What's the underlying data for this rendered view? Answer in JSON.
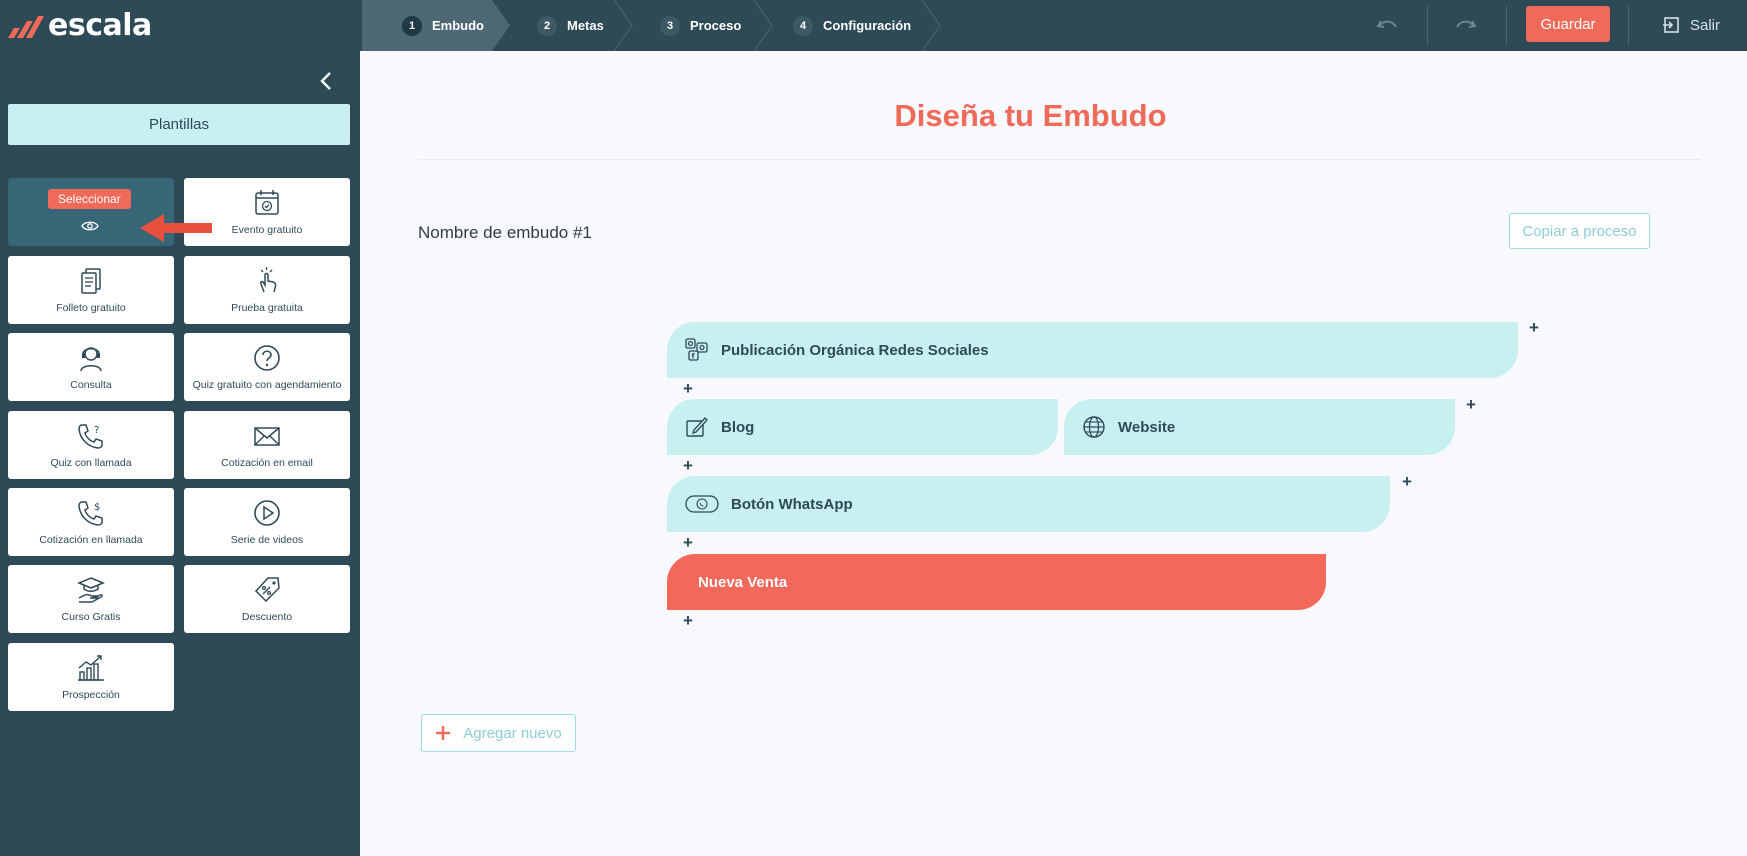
{
  "app": {
    "logo_text": "escala"
  },
  "steps": [
    {
      "num": "1",
      "label": "Embudo"
    },
    {
      "num": "2",
      "label": "Metas"
    },
    {
      "num": "3",
      "label": "Proceso"
    },
    {
      "num": "4",
      "label": "Configuración"
    }
  ],
  "toolbar": {
    "save_label": "Guardar",
    "exit_label": "Salir"
  },
  "sidebar": {
    "templates_label": "Plantillas",
    "selected_badge": "Seleccionar",
    "tiles": [
      {
        "label": "Evento gratuito",
        "icon": "calendar-check-icon"
      },
      {
        "label": "Folleto gratuito",
        "icon": "brochure-icon"
      },
      {
        "label": "Prueba gratuita",
        "icon": "pointer-click-icon"
      },
      {
        "label": "Consulta",
        "icon": "consultant-headset-icon"
      },
      {
        "label": "Quiz gratuito con agendamiento",
        "icon": "question-circle-icon"
      },
      {
        "label": "Quiz con llamada",
        "icon": "phone-question-icon"
      },
      {
        "label": "Cotización en email",
        "icon": "envelope-icon"
      },
      {
        "label": "Cotización en llamada",
        "icon": "phone-dollar-icon"
      },
      {
        "label": "Serie de videos",
        "icon": "play-circle-icon"
      },
      {
        "label": "Curso Gratis",
        "icon": "graduation-hand-icon"
      },
      {
        "label": "Descuento",
        "icon": "discount-tag-icon"
      },
      {
        "label": "Prospección",
        "icon": "growth-chart-icon"
      }
    ]
  },
  "main": {
    "title": "Diseña tu Embudo",
    "funnel_name": "Nombre de embudo #1",
    "copy_label": "Copiar a proceso",
    "add_label": "Agregar nuevo",
    "stages": {
      "social": "Publicación Orgánica Redes Sociales",
      "blog": "Blog",
      "website": "Website",
      "whatsapp": "Botón WhatsApp",
      "sale": "Nueva Venta"
    }
  },
  "colors": {
    "brand_dark": "#2e4a57",
    "accent": "#f06a5a",
    "stage_bg": "#c8f0f1"
  }
}
